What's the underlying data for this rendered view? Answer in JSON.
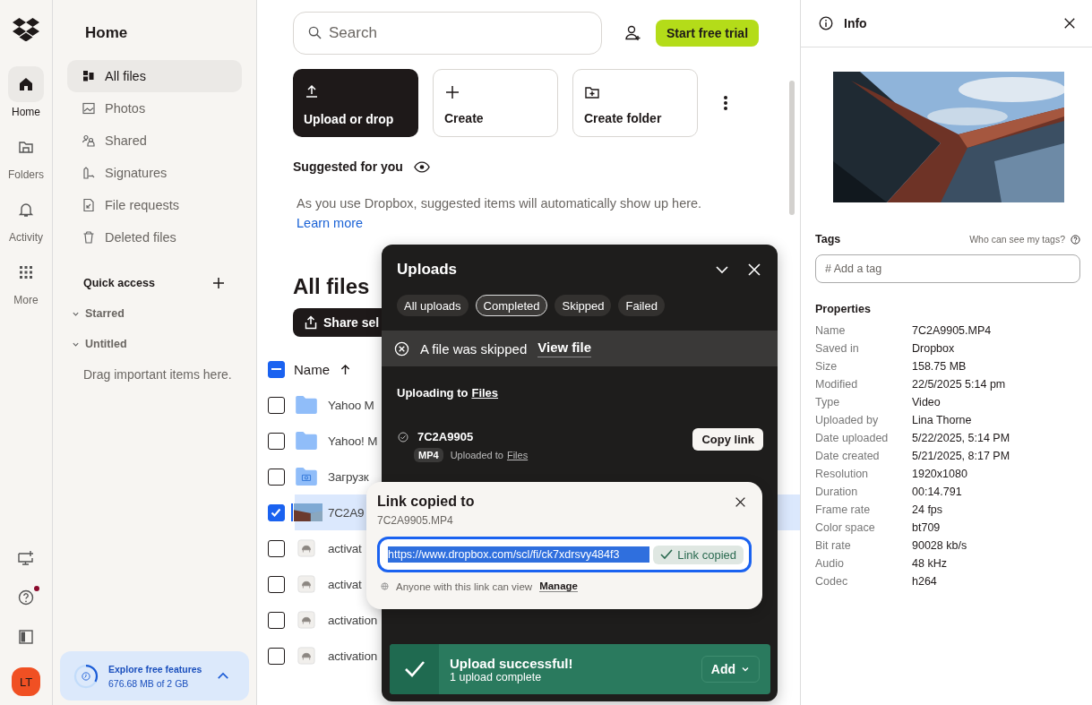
{
  "rail": {
    "items": [
      {
        "label": "Home",
        "selected": true
      },
      {
        "label": "Folders",
        "selected": false
      },
      {
        "label": "Activity",
        "selected": false
      },
      {
        "label": "More",
        "selected": false
      }
    ],
    "help_notification": true,
    "avatar": "LT"
  },
  "sidebar": {
    "title": "Home",
    "items": [
      {
        "label": "All files",
        "selected": true
      },
      {
        "label": "Photos",
        "selected": false
      },
      {
        "label": "Shared",
        "selected": false
      },
      {
        "label": "Signatures",
        "selected": false
      },
      {
        "label": "File requests",
        "selected": false
      },
      {
        "label": "Deleted files",
        "selected": false
      }
    ],
    "quick_access": "Quick access",
    "sections": [
      {
        "label": "Starred"
      },
      {
        "label": "Untitled"
      }
    ],
    "hint": "Drag important items here.",
    "storage": {
      "title": "Explore free features",
      "usage": "676.68 MB of 2 GB",
      "level": 0.33
    }
  },
  "search": {
    "placeholder": "Search"
  },
  "trial_button": "Start free trial",
  "actions": [
    {
      "label": "Upload or drop",
      "kind": "primary"
    },
    {
      "label": "Create",
      "kind": "secondary"
    },
    {
      "label": "Create folder",
      "kind": "secondary"
    }
  ],
  "suggested": {
    "title": "Suggested for you",
    "text": "As you use Dropbox, suggested items will automatically show up here.",
    "link": "Learn more"
  },
  "files": {
    "title": "All files",
    "share_button": "Share sel",
    "select_all_indeterminate": true,
    "name_column": "Name",
    "rows": [
      {
        "name": "Yahoo M",
        "kind": "folder",
        "checked": false
      },
      {
        "name": "Yahoo! M",
        "kind": "folder",
        "checked": false
      },
      {
        "name": "Загрузк",
        "kind": "camera-folder",
        "checked": false
      },
      {
        "name": "7C2A9",
        "kind": "video",
        "checked": true
      },
      {
        "name": "activat",
        "kind": "file",
        "checked": false
      },
      {
        "name": "activat",
        "kind": "file",
        "checked": false
      },
      {
        "name": "activation",
        "kind": "file",
        "checked": false
      },
      {
        "name": "activation",
        "kind": "file",
        "checked": false
      }
    ]
  },
  "uploads": {
    "title": "Uploads",
    "filters": [
      {
        "label": "All uploads",
        "selected": false
      },
      {
        "label": "Completed",
        "selected": true
      },
      {
        "label": "Skipped",
        "selected": false
      },
      {
        "label": "Failed",
        "selected": false
      }
    ],
    "notice": {
      "text": "A file was skipped",
      "link": "View file"
    },
    "destination": {
      "label": "Uploading to",
      "link": "Files"
    },
    "item": {
      "name": "7C2A9905",
      "type": "MP4",
      "status": "Uploaded to",
      "status_link": "Files",
      "button": "Copy link"
    },
    "success": {
      "title": "Upload successful!",
      "subtitle": "1 upload complete",
      "button": "Add"
    }
  },
  "link_popup": {
    "title": "Link copied to",
    "file": "7C2A9905.MP4",
    "url": "https://www.dropbox.com/scl/fi/ck7xdrsvy484f3",
    "status": "Link copied",
    "access": "Anyone with this link can view",
    "manage": "Manage"
  },
  "info": {
    "title": "Info",
    "tags_label": "Tags",
    "tags_help": "Who can see my tags?",
    "tag_placeholder": "# Add a tag",
    "properties_title": "Properties",
    "properties": [
      {
        "label": "Name",
        "value": "7C2A9905.MP4"
      },
      {
        "label": "Saved in",
        "value": "Dropbox"
      },
      {
        "label": "Size",
        "value": "158.75 MB"
      },
      {
        "label": "Modified",
        "value": "22/5/2025 5:14 pm"
      },
      {
        "label": "Type",
        "value": "Video"
      },
      {
        "label": "Uploaded by",
        "value": "Lina Thorne"
      },
      {
        "label": "Date uploaded",
        "value": "5/22/2025, 5:14 PM"
      },
      {
        "label": "Date created",
        "value": "5/21/2025, 8:17 PM"
      },
      {
        "label": "Resolution",
        "value": "1920x1080"
      },
      {
        "label": "Duration",
        "value": "00:14.791"
      },
      {
        "label": "Frame rate",
        "value": "24 fps"
      },
      {
        "label": "Color space",
        "value": "bt709"
      },
      {
        "label": "Bit rate",
        "value": "90028 kb/s"
      },
      {
        "label": "Audio",
        "value": "48 kHz"
      },
      {
        "label": "Codec",
        "value": "h264"
      }
    ]
  }
}
